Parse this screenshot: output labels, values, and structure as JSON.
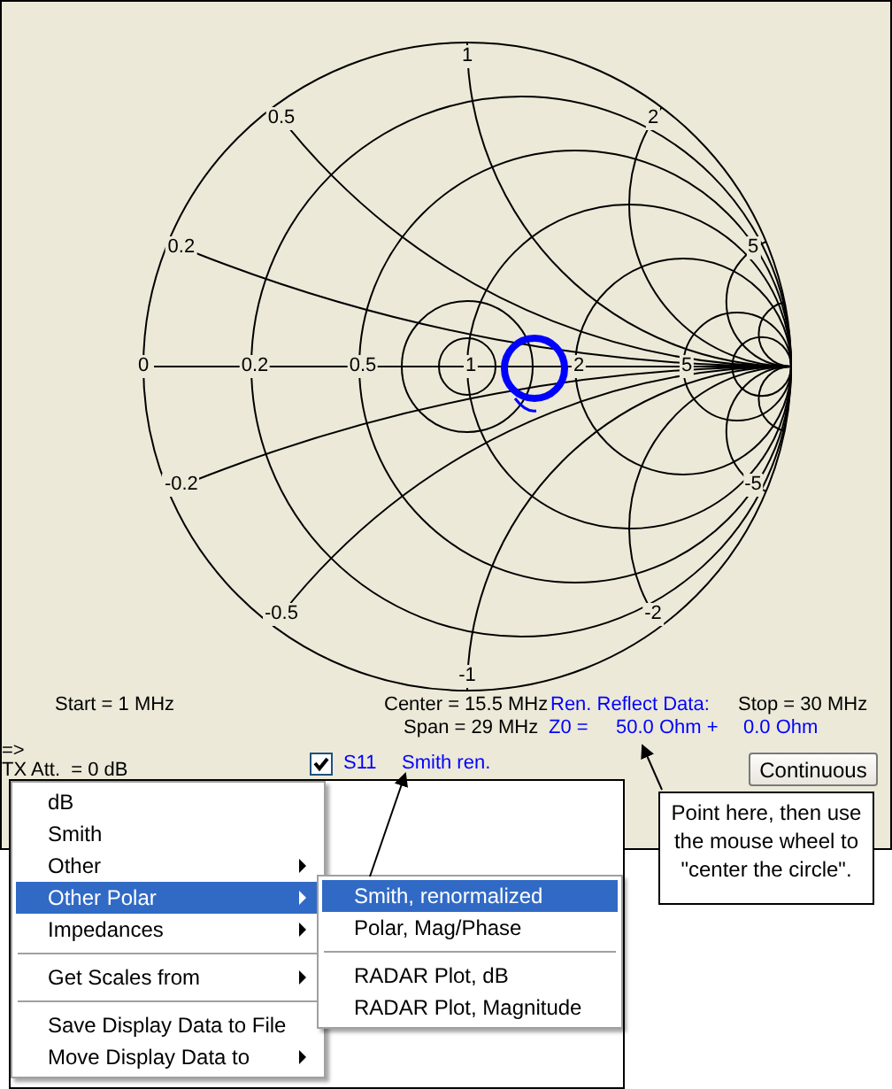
{
  "chart": {
    "resistance_labels": [
      "0",
      "0.2",
      "0.5",
      "1",
      "2",
      "5"
    ],
    "reactance_labels": [
      "1",
      "0.5",
      "2",
      "0.2",
      "5",
      "-0.2",
      "-5",
      "-0.5",
      "-2",
      "-1"
    ]
  },
  "sweep": {
    "start": "Start = 1 MHz",
    "center": "Center = 15.5 MHz",
    "span": "Span = 29 MHz",
    "stop": "Stop = 30 MHz"
  },
  "reflect": {
    "title": "Ren. Reflect Data:",
    "z0_label": "Z0 =",
    "real": "50.0 Ohm +",
    "imag": "0.0 Ohm"
  },
  "prompt": "=>",
  "tx_att": "TX Att.  = 0 dB",
  "trace": {
    "checked": true,
    "name": "S11",
    "mode": "Smith ren."
  },
  "button": "Continuous",
  "callout": "Point here, then use the mouse wheel to \"center the circle\".",
  "context_menu": {
    "items": [
      {
        "kind": "item",
        "label": "dB",
        "submenu": false,
        "selected": false
      },
      {
        "kind": "item",
        "label": "Smith",
        "submenu": false,
        "selected": false
      },
      {
        "kind": "item",
        "label": "Other",
        "submenu": true,
        "selected": false
      },
      {
        "kind": "item",
        "label": "Other Polar",
        "submenu": true,
        "selected": true
      },
      {
        "kind": "item",
        "label": "Impedances",
        "submenu": true,
        "selected": false
      },
      {
        "kind": "separator"
      },
      {
        "kind": "item",
        "label": "Get Scales from",
        "submenu": true,
        "selected": false
      },
      {
        "kind": "separator"
      },
      {
        "kind": "item",
        "label": "Save Display Data to File",
        "submenu": false,
        "selected": false
      },
      {
        "kind": "item",
        "label": "Move Display Data to",
        "submenu": true,
        "selected": false
      }
    ]
  },
  "submenu": {
    "items": [
      {
        "kind": "item",
        "label": "Smith, renormalized",
        "submenu": false,
        "selected": true
      },
      {
        "kind": "item",
        "label": "Polar, Mag/Phase",
        "submenu": false,
        "selected": false
      },
      {
        "kind": "separator"
      },
      {
        "kind": "item",
        "label": "RADAR Plot, dB",
        "submenu": false,
        "selected": false
      },
      {
        "kind": "item",
        "label": "RADAR Plot, Magnitude",
        "submenu": false,
        "selected": false
      }
    ]
  }
}
